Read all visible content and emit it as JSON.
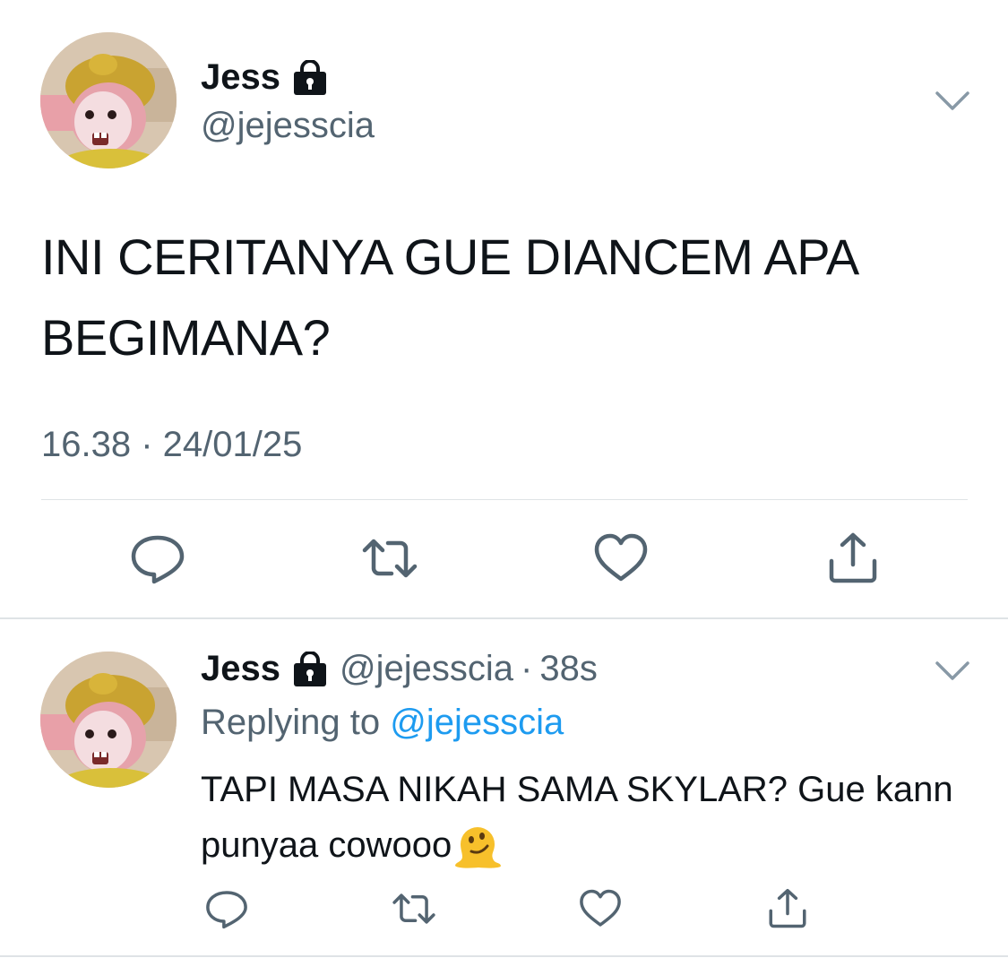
{
  "main_tweet": {
    "author": {
      "display_name": "Jess",
      "handle": "@jejesscia",
      "protected": true
    },
    "text": "INI CERITANYA GUE DIANCEM APA BEGIMANA?",
    "timestamp": "16.38 · 24/01/25",
    "actions": [
      "reply-icon",
      "retweet-icon",
      "like-icon",
      "share-icon"
    ]
  },
  "reply_tweet": {
    "author": {
      "display_name": "Jess",
      "handle": "@jejesscia",
      "protected": true
    },
    "dot": "·",
    "time": "38s",
    "replying_prefix": "Replying to",
    "replying_to": "@jejesscia",
    "text": "TAPI MASA NIKAH SAMA SKYLAR? Gue kann punyaa cowooo",
    "emoji": "melting-face-emoji",
    "actions": [
      "reply-icon",
      "retweet-icon",
      "like-icon",
      "share-icon"
    ]
  },
  "colors": {
    "text_primary": "#0f1419",
    "text_secondary": "#536471",
    "link": "#1d9bf0",
    "divider": "#dfe3e6"
  }
}
